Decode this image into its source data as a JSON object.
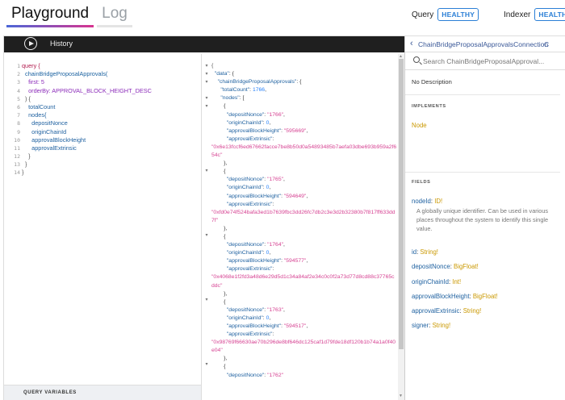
{
  "header": {
    "tabs": [
      {
        "label": "Playground",
        "active": true
      },
      {
        "label": "Log",
        "active": false
      }
    ],
    "status": [
      {
        "label": "Query",
        "badge": "HEALTHY"
      },
      {
        "label": "Indexer",
        "badge": "HEALTHY"
      }
    ]
  },
  "toolbar": {
    "run_icon": "play-icon",
    "history_label": "History"
  },
  "editor": {
    "line_numbers": [
      "1",
      "2",
      "3",
      "4",
      "5",
      "6",
      "7",
      "8",
      "9",
      "10",
      "11",
      "12",
      "13",
      "14"
    ],
    "lines": [
      "query {",
      "  chainBridgeProposalApprovals(",
      "    first: 5",
      "    orderBy: APPROVAL_BLOCK_HEIGHT_DESC",
      "  ) {",
      "    totalCount",
      "    nodes{",
      "      depositNonce",
      "      originChainId",
      "      approvalBlockHeight",
      "      approvalExtrinsic",
      "    }",
      "  }",
      "}"
    ],
    "query_variables_label": "QUERY VARIABLES"
  },
  "result": {
    "open_brace": "{",
    "data_key": "\"data\"",
    "root_key": "\"chainBridgeProposalApprovals\"",
    "total_count_key": "\"totalCount\"",
    "total_count": "1766",
    "nodes_key": "\"nodes\"",
    "keys": {
      "deposit_nonce": "\"depositNonce\"",
      "origin_chain_id": "\"originChainId\"",
      "approval_block_height": "\"approvalBlockHeight\"",
      "approval_extrinsic": "\"approvalExtrinsic\""
    },
    "nodes": [
      {
        "depositNonce": "\"1766\"",
        "originChainId": "0",
        "approvalBlockHeight": "\"595669\"",
        "approvalExtrinsic": "\"0x6e13fccf6ed67662facce7be8b50d0a54893485b7aefa03dbe693b959a2f654c\""
      },
      {
        "depositNonce": "\"1765\"",
        "originChainId": "0",
        "approvalBlockHeight": "\"594649\"",
        "approvalExtrinsic": "\"0xfd0e74f524bafa3ed1b7639fbc3dd26fc7db2c3e3d2b32380b7f817ff633dd7f\""
      },
      {
        "depositNonce": "\"1764\"",
        "originChainId": "0",
        "approvalBlockHeight": "\"594577\"",
        "approvalExtrinsic": "\"0x4068e1f2fd3a48d6e29d5d1c34a84af2e34c0c0f2a73d77d8cd88c37765cddc\""
      },
      {
        "depositNonce": "\"1763\"",
        "originChainId": "0",
        "approvalBlockHeight": "\"594517\"",
        "approvalExtrinsic": "\"0x98769f66630ae70b296de8bf646dc125caf1d79fde18df120b1b74a1a0f40e04\""
      },
      {
        "depositNonce": "\"1762\""
      }
    ]
  },
  "docs": {
    "title": "ChainBridgeProposalApprovalsConnection",
    "close_label": "C",
    "search_placeholder": "Search ChainBridgeProposalApproval...",
    "no_description": "No Description",
    "implements_label": "IMPLEMENTS",
    "implements_type": "Node",
    "fields_label": "FIELDS",
    "fields": [
      {
        "name": "nodeId",
        "type": "ID!",
        "description": "A globally unique identifier. Can be used in various places throughout the system to identify this single value."
      },
      {
        "name": "id",
        "type": "String!"
      },
      {
        "name": "depositNonce",
        "type": "BigFloat!"
      },
      {
        "name": "originChainId",
        "type": "Int!"
      },
      {
        "name": "approvalBlockHeight",
        "type": "BigFloat!"
      },
      {
        "name": "approvalExtrinsic",
        "type": "String!"
      },
      {
        "name": "signer",
        "type": "String!"
      }
    ]
  }
}
